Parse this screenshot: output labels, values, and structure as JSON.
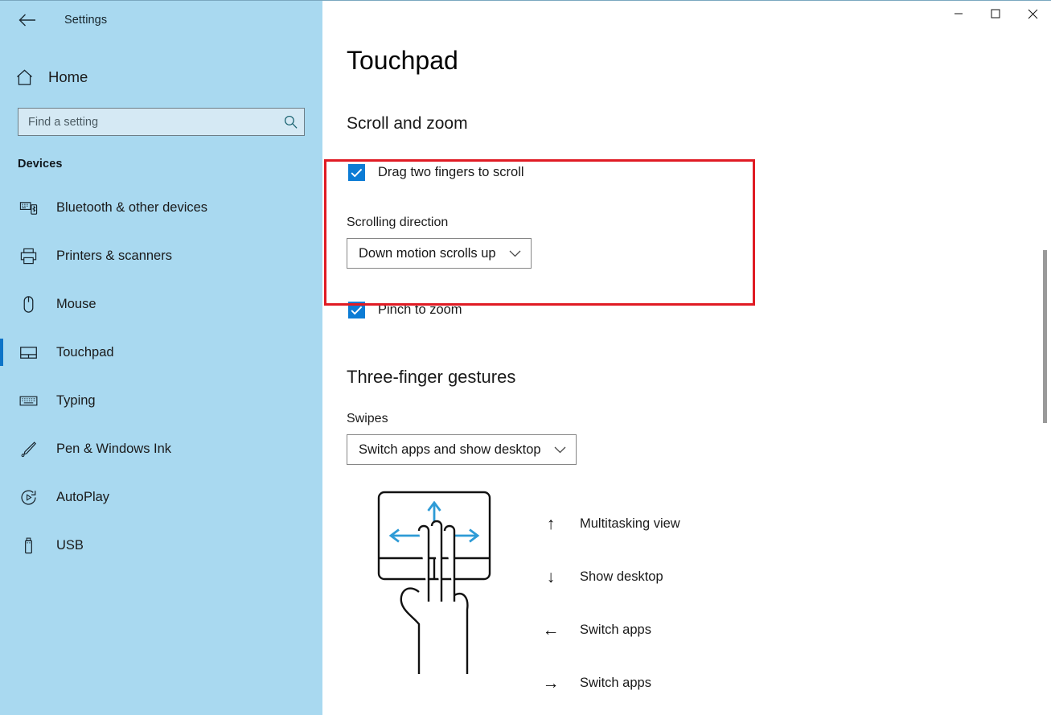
{
  "titlebar": {
    "back_icon": "back-arrow-icon",
    "app_title": "Settings",
    "minimize_label": "–",
    "maximize_label": "□",
    "close_label": "✕"
  },
  "sidebar": {
    "home_label": "Home",
    "home_icon": "home-icon",
    "search": {
      "placeholder": "Find a setting",
      "value": "",
      "icon": "search-icon"
    },
    "section_label": "Devices",
    "items": [
      {
        "label": "Bluetooth & other devices",
        "icon": "bluetooth-devices-icon",
        "selected": false
      },
      {
        "label": "Printers & scanners",
        "icon": "printer-icon",
        "selected": false
      },
      {
        "label": "Mouse",
        "icon": "mouse-icon",
        "selected": false
      },
      {
        "label": "Touchpad",
        "icon": "touchpad-icon",
        "selected": true
      },
      {
        "label": "Typing",
        "icon": "keyboard-icon",
        "selected": false
      },
      {
        "label": "Pen & Windows Ink",
        "icon": "pen-icon",
        "selected": false
      },
      {
        "label": "AutoPlay",
        "icon": "autoplay-icon",
        "selected": false
      },
      {
        "label": "USB",
        "icon": "usb-icon",
        "selected": false
      }
    ]
  },
  "main": {
    "page_title": "Touchpad",
    "scroll_zoom": {
      "group_title": "Scroll and zoom",
      "drag_two_fingers_label": "Drag two fingers to scroll",
      "drag_two_fingers_checked": true,
      "scrolling_direction_label": "Scrolling direction",
      "scrolling_direction_value": "Down motion scrolls up",
      "pinch_to_zoom_label": "Pinch to zoom",
      "pinch_to_zoom_checked": true
    },
    "three_finger": {
      "group_title": "Three-finger gestures",
      "swipes_label": "Swipes",
      "swipes_value": "Switch apps and show desktop",
      "gesture_illustration": "three-finger-swipe-illustration",
      "legend": [
        {
          "arrow": "↑",
          "text": "Multitasking view"
        },
        {
          "arrow": "↓",
          "text": "Show desktop"
        },
        {
          "arrow": "←",
          "text": "Switch apps"
        },
        {
          "arrow": "→",
          "text": "Switch apps"
        }
      ]
    }
  },
  "colors": {
    "sidebar_bg": "#a9d9f0",
    "accent_blue": "#0e74c8",
    "checkbox_blue": "#0c7cd5",
    "highlight_red": "#e01b24",
    "illustration_arrow_blue": "#2e9bd6"
  }
}
